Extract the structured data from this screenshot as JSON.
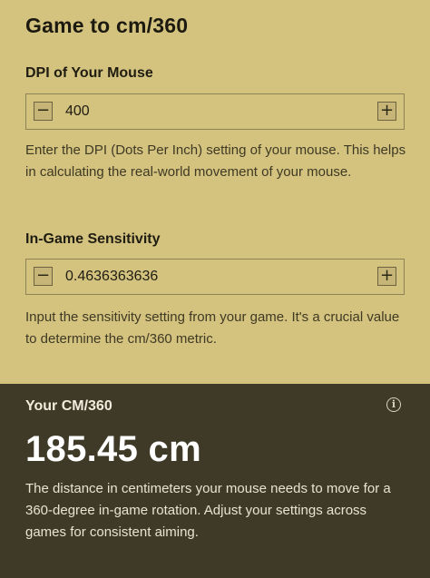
{
  "title": "Game to cm/360",
  "dpi": {
    "label": "DPI of Your Mouse",
    "value": "400",
    "minus_label": "−",
    "plus_label": "+",
    "help": "Enter the DPI (Dots Per Inch) setting of your mouse. This helps in calculating the real-world movement of your mouse."
  },
  "sensitivity": {
    "label": "In-Game Sensitivity",
    "value": "0.4636363636",
    "minus_label": "−",
    "plus_label": "+",
    "help": "Input the sensitivity setting from your game. It's a crucial value to determine the cm/360 metric."
  },
  "result": {
    "label": "Your CM/360",
    "info_icon": "i",
    "value": "185.45 cm",
    "description": "The distance in centimeters your mouse needs to move for a 360-degree in-game rotation. Adjust your settings across games for consistent aiming."
  },
  "colors": {
    "background": "#d4c27f",
    "result_background": "#3f3a28"
  }
}
